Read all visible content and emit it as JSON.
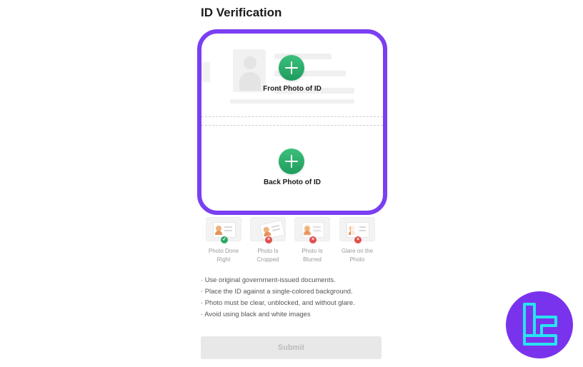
{
  "page": {
    "title": "ID Verification"
  },
  "upload": {
    "front_label": "Front Photo of ID",
    "back_label": "Back Photo of ID"
  },
  "examples": [
    {
      "label": "Photo Done Right",
      "status": "ok",
      "status_glyph": "✓"
    },
    {
      "label": "Photo Is Cropped",
      "status": "bad",
      "status_glyph": "×"
    },
    {
      "label": "Photo Is Blurred",
      "status": "bad",
      "status_glyph": "×"
    },
    {
      "label": "Glare on the Photo",
      "status": "bad",
      "status_glyph": "×"
    }
  ],
  "tips": [
    "· Use original government-issued documents.",
    "· Place the ID against a single-colored background.",
    "· Photo must be clear, unblocked, and without glare.",
    "· Avoid using black and white images"
  ],
  "submit": {
    "label": "Submit",
    "enabled": false
  },
  "colors": {
    "frame_highlight": "#7a3ff2",
    "add_button": "#2aa867",
    "logo_background": "#7a33ec",
    "logo_mark": "#27e3f0"
  }
}
